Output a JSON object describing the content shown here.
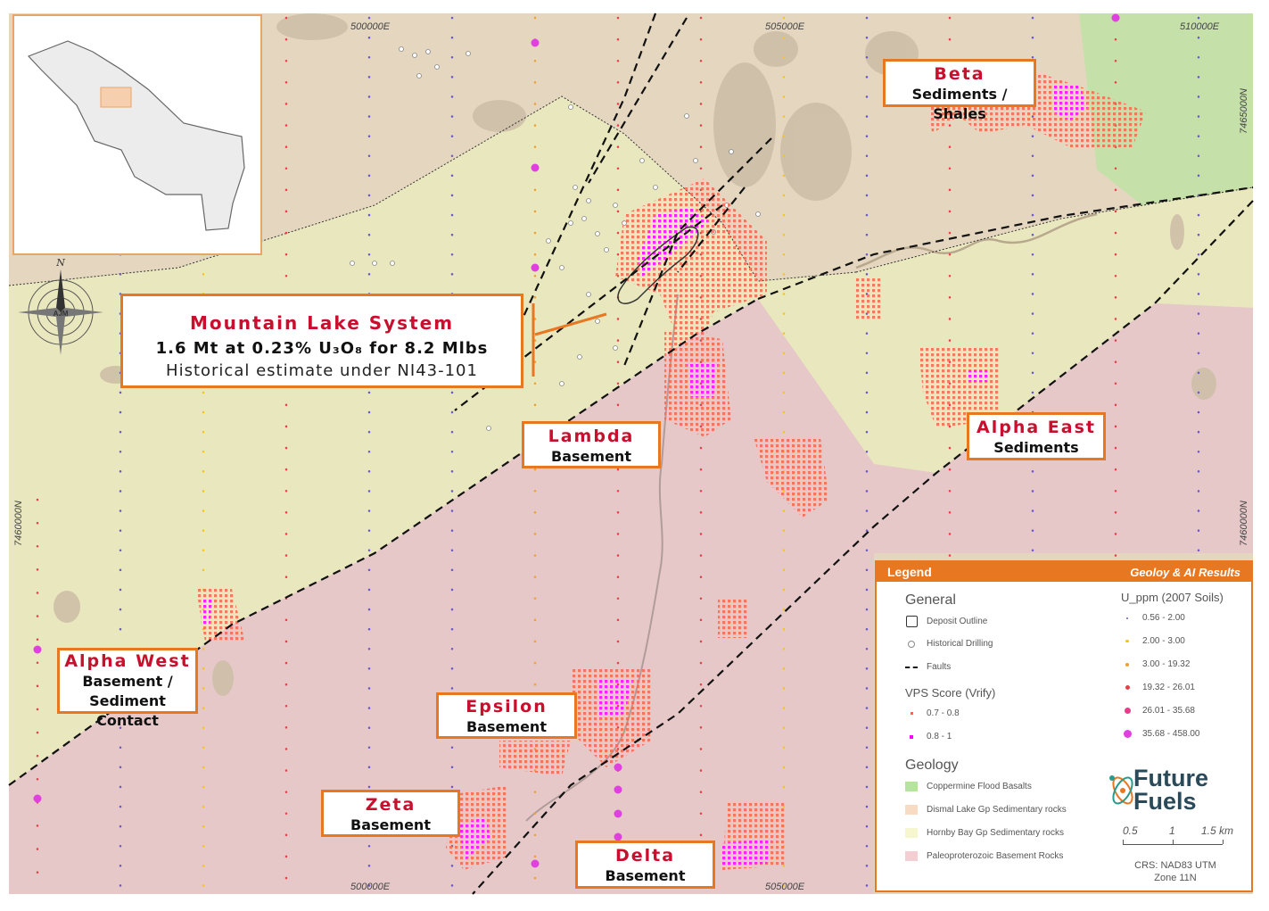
{
  "coords": {
    "top_left_e": "500000E",
    "top_mid_e": "505000E",
    "top_right_e": "510000E",
    "bottom_left_e": "500000E",
    "bottom_mid_e": "505000E",
    "right_top_n": "7465000N",
    "right_bottom_n": "7460000N",
    "left_n": "7460000N"
  },
  "north": {
    "letter": "N",
    "label": "AJM"
  },
  "mountain_lake": {
    "title": "Mountain Lake System",
    "line1": "1.6 Mt at 0.23% U₃O₈ for 8.2 Mlbs",
    "line2": "Historical estimate under NI43-101"
  },
  "targets": [
    {
      "name": "Beta",
      "desc": "Sediments / Shales"
    },
    {
      "name": "Lambda",
      "desc": "Basement"
    },
    {
      "name": "Alpha East",
      "desc": "Sediments"
    },
    {
      "name": "Alpha West",
      "desc": "Basement /",
      "desc2": "Sediment Contact"
    },
    {
      "name": "Epsilon",
      "desc": "Basement"
    },
    {
      "name": "Zeta",
      "desc": "Basement"
    },
    {
      "name": "Delta",
      "desc": "Basement"
    }
  ],
  "legend": {
    "title": "Legend",
    "subtitle": "Geoloy & AI Results",
    "general_title": "General",
    "general_items": [
      "Deposit Outline",
      "Historical Drilling",
      "Faults"
    ],
    "vps_title": "VPS Score (Vrify)",
    "vps_items": [
      "0.7 - 0.8",
      "0.8 - 1"
    ],
    "geology_title": "Geology",
    "geology_items": [
      {
        "label": "Coppermine Flood Basalts",
        "color": "#b5e3a0"
      },
      {
        "label": "Dismal Lake Gp Sedimentary rocks",
        "color": "#f7dcc3"
      },
      {
        "label": "Hornby Bay Gp Sedimentary rocks",
        "color": "#f6f6cf"
      },
      {
        "label": "Paleoproterozoic Basement Rocks",
        "color": "#f3cfd3"
      }
    ],
    "u_title": "U_ppm (2007 Soils)",
    "u_items": [
      {
        "label": "0.56 - 2.00",
        "color": "#6a5acd"
      },
      {
        "label": "2.00 - 3.00",
        "color": "#f5c518"
      },
      {
        "label": "3.00 - 19.32",
        "color": "#f0a030"
      },
      {
        "label": "19.32 - 26.01",
        "color": "#e8404a"
      },
      {
        "label": "26.01 - 35.68",
        "color": "#e83c8c"
      },
      {
        "label": "35.68 - 458.00",
        "color": "#e040e0"
      }
    ],
    "logo_line1": "Future",
    "logo_line2": "Fuels",
    "scale": [
      "0.5",
      "1",
      "1.5 km"
    ],
    "crs1": "CRS: NAD83 UTM",
    "crs2": "Zone 11N"
  },
  "colors": {
    "accent": "#e87722",
    "title_red": "#c8102e",
    "basement": "#e9c9c9",
    "hornby": "#ecebc0",
    "dismal": "#e6d8c0",
    "basalt": "#b5e3a0",
    "vps_magenta": "#ff00ff"
  }
}
